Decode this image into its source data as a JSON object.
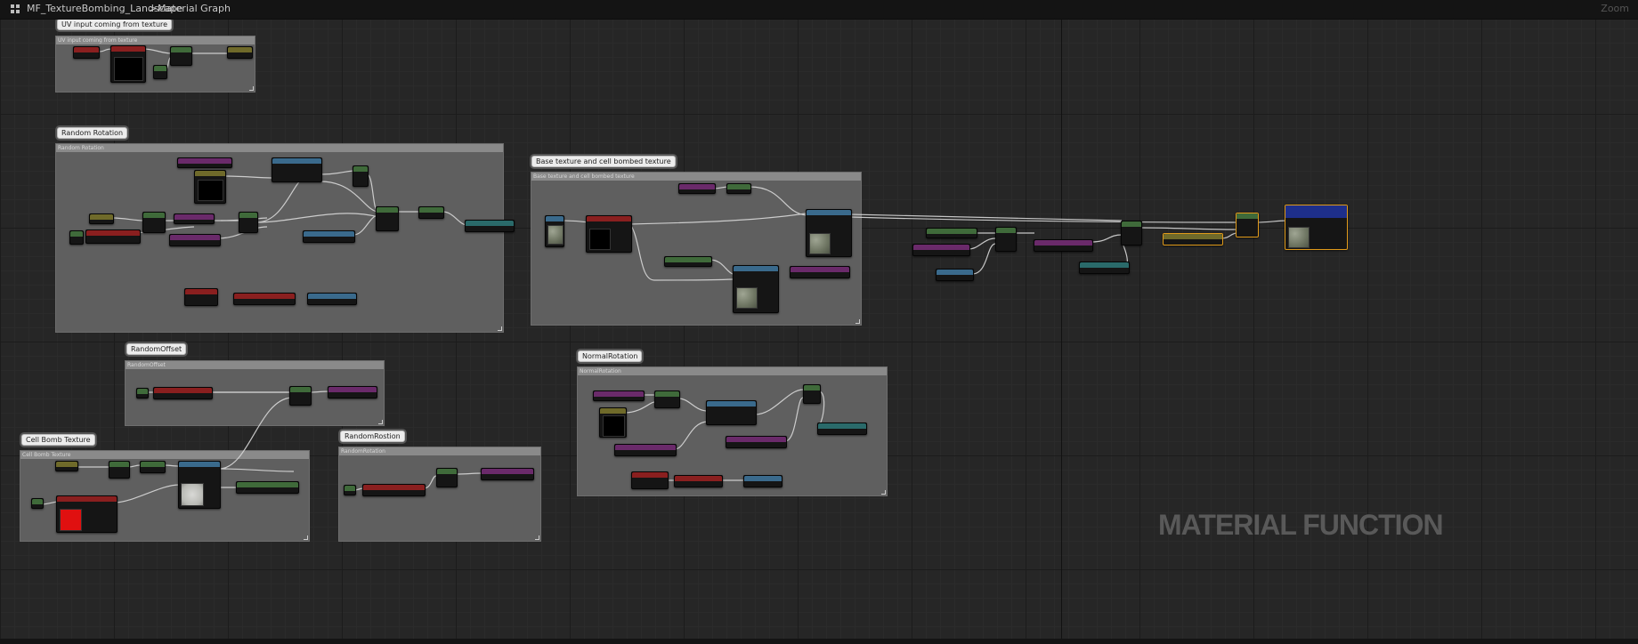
{
  "window": {
    "breadcrumb": [
      "MF_TextureBombing_Landscape",
      "Material Graph"
    ],
    "separator": ">",
    "zoom_label": "Zoom"
  },
  "watermark": "MATERIAL FUNCTION",
  "comments": [
    {
      "id": "uv-input",
      "bubble": "UV input coming from texture",
      "title": "UV input coming from texture"
    },
    {
      "id": "random-rotation",
      "bubble": "Random Rotation",
      "title": "Random Rotation"
    },
    {
      "id": "base-texture",
      "bubble": "Base texture and cell bombed texture",
      "title": "Base texture and cell bombed texture"
    },
    {
      "id": "random-offset",
      "bubble": "RandomOffset",
      "title": "RandomOffset"
    },
    {
      "id": "normal-rotation",
      "bubble": "NormalRotation",
      "title": "NormalRotation"
    },
    {
      "id": "cell-bomb-texture",
      "bubble": "Cell Bomb Texture",
      "title": "Cell Bomb Texture"
    },
    {
      "id": "random-rotation-2",
      "bubble": "RandomRostion",
      "title": "RandomRotation"
    }
  ],
  "colors": {
    "graph_bg": "#262626",
    "comment_body": "#5f5f5f",
    "comment_title": "#8a8a8a",
    "node_body": "#151515",
    "selected_outline": "#e09a1a",
    "wire": "#d8d8d8"
  },
  "node_header_colors": {
    "red": "#8a1f1f",
    "green": "#3f6a3a",
    "olive": "#6f6a2a",
    "blue": "#3a6a8c",
    "purple": "#6a2a6a",
    "teal": "#2a6a6a",
    "navy": "#1e2f8a",
    "gold": "#a07010",
    "slate": "#4a5a6a"
  }
}
